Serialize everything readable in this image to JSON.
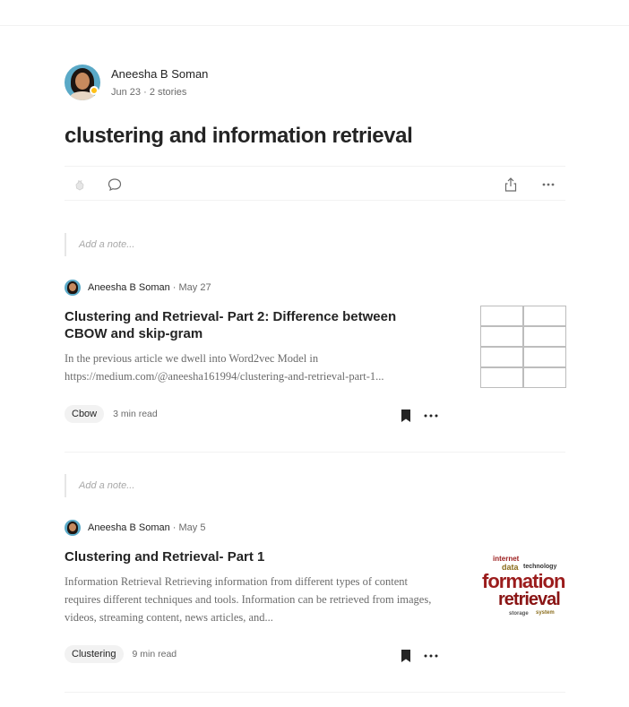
{
  "list": {
    "author_name": "Aneesha B Soman",
    "date": "Jun 23",
    "separator": "·",
    "story_count": "2 stories",
    "title": "clustering and information retrieval"
  },
  "actions": {
    "clap_icon": "clap-icon",
    "comment_icon": "comment-icon",
    "share_icon": "share-icon",
    "more_icon": "more-icon"
  },
  "stories": [
    {
      "note_placeholder": "Add a note...",
      "author": "Aneesha B Soman",
      "date": "· May 27",
      "title": "Clustering and Retrieval- Part 2: Difference between CBOW and skip-gram",
      "excerpt": "In the previous article we dwell into Word2vec Model in https://medium.com/@aneesha161994/clustering-and-retrieval-part-1...",
      "tag": "Cbow",
      "read_time": "3 min read"
    },
    {
      "note_placeholder": "Add a note...",
      "author": "Aneesha B Soman",
      "date": "· May 5",
      "title": "Clustering and Retrieval- Part 1",
      "excerpt": "Information Retrieval Retrieving information from different types of content requires different techniques and tools. Information can be retrieved from images, videos, streaming content, news articles, and...",
      "tag": "Clustering",
      "read_time": "9 min read"
    }
  ],
  "wordcloud": {
    "w1": "internet",
    "w2": "data",
    "w3": "technology",
    "w4": "formation",
    "w5": "retrieval",
    "w6": "storage",
    "w7": "system"
  },
  "colors": {
    "text": "#242424",
    "muted": "#6b6b6b",
    "divider": "#f2f2f2",
    "badge": "#ffc017",
    "wordcloud_red": "#9b1c1c"
  }
}
